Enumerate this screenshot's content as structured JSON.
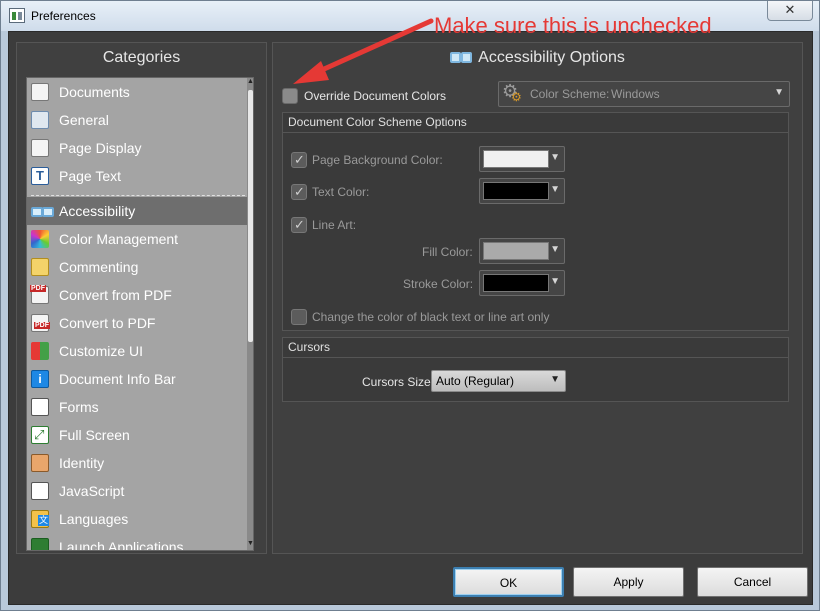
{
  "window": {
    "title": "Preferences",
    "close_glyph": "✕"
  },
  "categories": {
    "header": "Categories",
    "items": [
      {
        "label": "Documents",
        "icon": "document-icon"
      },
      {
        "label": "General",
        "icon": "general-icon"
      },
      {
        "label": "Page Display",
        "icon": "page-display-icon"
      },
      {
        "label": "Page Text",
        "icon": "page-text-icon",
        "glyph": "T"
      },
      {
        "label": "Accessibility",
        "icon": "glasses-icon",
        "selected": true
      },
      {
        "label": "Color Management",
        "icon": "color-wheel-icon"
      },
      {
        "label": "Commenting",
        "icon": "comment-icon"
      },
      {
        "label": "Convert from PDF",
        "icon": "convert-from-pdf-icon"
      },
      {
        "label": "Convert to PDF",
        "icon": "convert-to-pdf-icon"
      },
      {
        "label": "Customize UI",
        "icon": "customize-ui-icon"
      },
      {
        "label": "Document Info Bar",
        "icon": "info-icon",
        "glyph": "i"
      },
      {
        "label": "Forms",
        "icon": "forms-icon"
      },
      {
        "label": "Full Screen",
        "icon": "full-screen-icon"
      },
      {
        "label": "Identity",
        "icon": "identity-icon"
      },
      {
        "label": "JavaScript",
        "icon": "javascript-icon"
      },
      {
        "label": "Languages",
        "icon": "languages-icon"
      },
      {
        "label": "Launch Applications",
        "icon": "launch-applications-icon"
      }
    ]
  },
  "options": {
    "header": "Accessibility Options",
    "override_label": "Override Document Colors",
    "override_checked": false,
    "color_scheme_label": "Color Scheme:",
    "color_scheme_value": "Windows",
    "doc_scheme": {
      "title": "Document Color Scheme Options",
      "page_bg_label": "Page Background Color:",
      "page_bg_color": "#f0f0f0",
      "text_color_label": "Text Color:",
      "text_color": "#000000",
      "line_art_label": "Line Art:",
      "fill_label": "Fill Color:",
      "fill_color": "#aaaaaa",
      "stroke_label": "Stroke Color:",
      "stroke_color": "#000000",
      "black_only_label": "Change the color of black text or line art only"
    },
    "cursors": {
      "title": "Cursors",
      "size_label": "Cursors Size:",
      "size_value": "Auto (Regular)"
    }
  },
  "buttons": {
    "ok": "OK",
    "apply": "Apply",
    "cancel": "Cancel"
  },
  "annotation": {
    "text": "Make sure this is unchecked",
    "color": "#e53935"
  }
}
